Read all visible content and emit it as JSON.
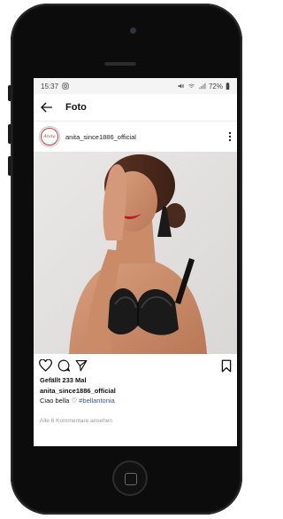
{
  "status_bar": {
    "time": "15:37",
    "battery": "72%"
  },
  "app_bar": {
    "title": "Foto"
  },
  "post": {
    "username": "anita_since1886_official",
    "avatar_text": "Anita",
    "likes": "Gefällt 233 Mal",
    "caption_user": "anita_since1886_official",
    "caption_text": "Ciao bella ♡",
    "caption_hashtag": "#bellantonia",
    "comments_link": "Alle 6 Kommentare ansehen"
  },
  "colors": {
    "accent_red": "#c53b3b",
    "hashtag_blue": "#365a8c"
  },
  "icons": {
    "back": "arrow-left-icon",
    "more": "more-vertical-icon",
    "like": "heart-icon",
    "comment": "comment-icon",
    "share": "send-icon",
    "save": "bookmark-icon"
  }
}
